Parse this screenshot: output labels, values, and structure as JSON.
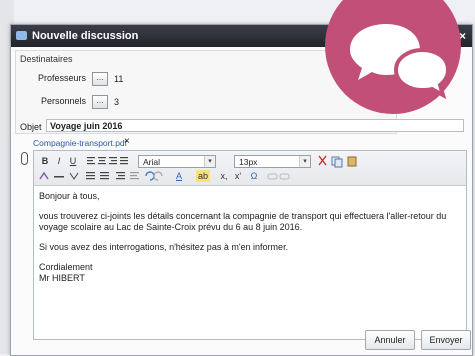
{
  "window": {
    "title": "Nouvelle discussion",
    "close_glyph": "×"
  },
  "recipients": {
    "legend": "Destinataires",
    "rows": [
      {
        "label": "Professeurs",
        "button": "…",
        "count": "11"
      },
      {
        "label": "Personnels",
        "button": "…",
        "count": "3"
      }
    ]
  },
  "subject": {
    "label": "Objet",
    "value": "Voyage juin 2016"
  },
  "attachment": {
    "name": "Compagnie-transport.pdf",
    "remove": "×"
  },
  "toolbar": {
    "bold": "B",
    "italic": "I",
    "underline": "U",
    "font_family": "Arial",
    "font_size": "13px",
    "text_color_label": "A",
    "highlight_label": "ab",
    "subscript": "x,",
    "superscript": "x'",
    "omega": "Ω"
  },
  "message": {
    "greeting": "Bonjour à tous,",
    "paragraph1": "vous trouverez ci-joints les détails concernant la compagnie de transport qui effectuera l'aller-retour du voyage scolaire au Lac de Sainte-Croix prévu du 6 au 8 juin 2016.",
    "paragraph2": "Si vous avez des interrogations, n'hésitez pas à m'en informer.",
    "closing": "Cordialement",
    "signature": "Mr HIBERT"
  },
  "buttons": {
    "cancel": "Annuler",
    "send": "Envoyer"
  },
  "colors": {
    "brand_circle": "#c24f77",
    "titlebar": "#2a2c35",
    "link": "#2b59a8"
  },
  "icons": [
    "chat-bubbles-icon",
    "paperclip-icon",
    "app-icon",
    "close-icon"
  ]
}
